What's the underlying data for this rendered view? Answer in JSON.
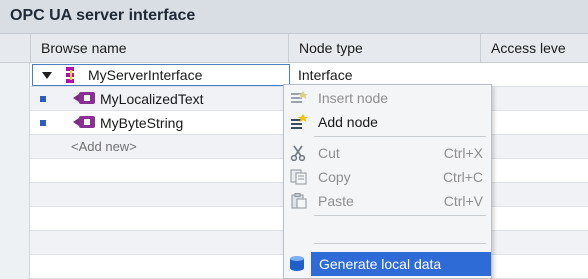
{
  "panel": {
    "title": "OPC UA server interface"
  },
  "columns": {
    "browse_name": "Browse name",
    "node_type": "Node type",
    "access_level": "Access leve"
  },
  "rows": [
    {
      "name": "MyServerInterface",
      "node_type": "Interface",
      "icon": "interface-icon",
      "expanded": true
    },
    {
      "name": "MyLocalizedText",
      "icon": "variable-icon"
    },
    {
      "name": "MyByteString",
      "icon": "variable-icon"
    },
    {
      "add_new": "<Add new>"
    }
  ],
  "context_menu": {
    "items": [
      {
        "label": "Insert node",
        "icon": "insert-node-icon",
        "enabled": false
      },
      {
        "label": "Add node",
        "icon": "add-node-icon",
        "enabled": true
      },
      {
        "label": "Cut",
        "shortcut": "Ctrl+X",
        "icon": "scissors-icon",
        "enabled": false
      },
      {
        "label": "Copy",
        "shortcut": "Ctrl+C",
        "icon": "copy-icon",
        "enabled": false
      },
      {
        "label": "Paste",
        "shortcut": "Ctrl+V",
        "icon": "paste-icon",
        "enabled": false
      },
      {
        "label": "Generate local data",
        "icon": "database-icon",
        "enabled": true,
        "highlighted": true
      }
    ]
  },
  "colors": {
    "highlight": "#2e6bd6",
    "interface_icon": "#b10fb5",
    "variable_icon": "#8a2f95",
    "bullet": "#2c5cbf"
  }
}
